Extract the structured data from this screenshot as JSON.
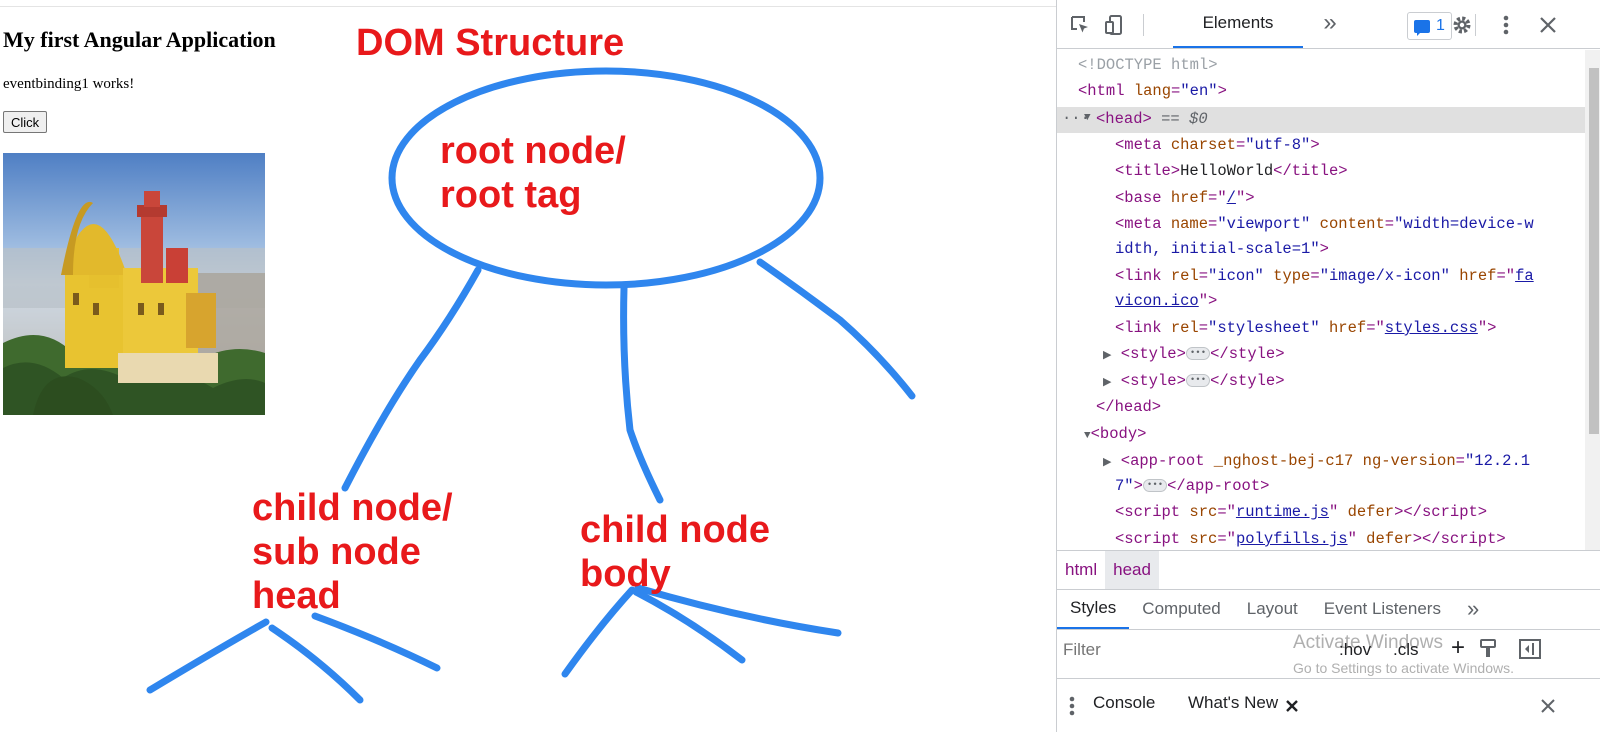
{
  "page": {
    "title": "My first Angular Application",
    "works_text": "eventbinding1 works!",
    "button_label": "Click"
  },
  "annotations": {
    "heading": "DOM Structure",
    "root_line1": "root node/",
    "root_line2": "root tag",
    "head_line1": "child node/",
    "head_line2": "sub node",
    "head_line3": "head",
    "body_line1": "child node",
    "body_line2": "body",
    "ink_color": "#e8191b",
    "pen_color": "#2f86ee"
  },
  "devtools": {
    "tab_elements": "Elements",
    "more_tabs": "»",
    "issues_count": "1",
    "dom": {
      "doctype": "<!DOCTYPE html>",
      "html_open_a": "<html ",
      "html_lang_attr": "lang",
      "html_lang_val": "\"en\"",
      "head_tag": "<head>",
      "head_marker": " == $0",
      "meta_charset_attr": "charset",
      "meta_charset_val": "\"utf-8\"",
      "title_text": "HelloWorld",
      "base_href_val": "/",
      "meta_name_val": "\"viewport\"",
      "meta_content_val_1": "\"width=device-w",
      "meta_content_val_2": "idth, initial-scale=1\"",
      "link_rel_icon_val": "\"icon\"",
      "link_type_val": "\"image/x-icon\"",
      "link_href_1": "fa",
      "link_href_2": "vicon.ico",
      "stylesheet_rel_val": "\"stylesheet\"",
      "stylesheet_href": "styles.css",
      "style_open": "<style>",
      "style_close": "</style>",
      "head_close": "</head>",
      "body_tag": "<body>",
      "approot_open": "<app-root ",
      "approot_attr1": "_nghost-bej-c17",
      "approot_attr2": "ng-version",
      "approot_val_1": "\"12.2.1",
      "approot_val_2": "7\"",
      "approot_close": "</app-root>",
      "script1_src": "runtime.js",
      "script2_src": "polyfills.js"
    },
    "breadcrumbs": [
      "html",
      "head"
    ],
    "subtabs": [
      "Styles",
      "Computed",
      "Layout",
      "Event Listeners"
    ],
    "filter_placeholder": "Filter",
    "hov_label": ":hov",
    "cls_label": ".cls",
    "plus_label": "+",
    "watermark_line1": "Activate Windows",
    "watermark_line2": "Go to Settings to activate Windows.",
    "drawer_console": "Console",
    "drawer_whats_new": "What's New",
    "accent_color": "#1a73e8"
  }
}
